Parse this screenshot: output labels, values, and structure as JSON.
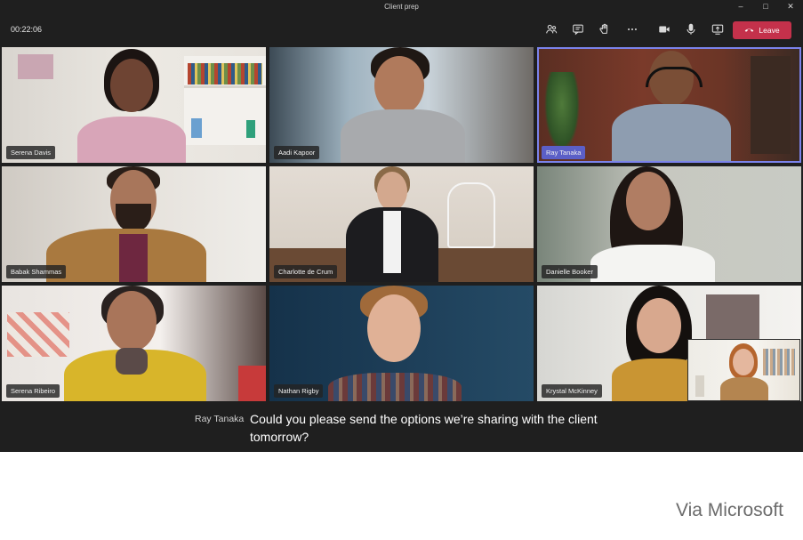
{
  "window": {
    "title": "Client prep"
  },
  "window_controls": {
    "minimize": "–",
    "maximize": "□",
    "close": "✕"
  },
  "toolbar": {
    "timer": "00:22:06",
    "icons": [
      "people-icon",
      "chat-icon",
      "raise-hand-icon",
      "more-icon",
      "camera-icon",
      "mic-icon",
      "share-screen-icon"
    ],
    "leave_label": "Leave"
  },
  "participants": [
    {
      "name": "Serena Davis"
    },
    {
      "name": "Aadi Kapoor"
    },
    {
      "name": "Ray Tanaka",
      "active": true
    },
    {
      "name": "Babak Shammas"
    },
    {
      "name": "Charlotte de Crum"
    },
    {
      "name": "Danielle Booker"
    },
    {
      "name": "Serena Ribeiro"
    },
    {
      "name": "Nathan Rigby"
    },
    {
      "name": "Krystal McKinney"
    }
  ],
  "caption": {
    "speaker": "Ray Tanaka",
    "text": "Could you please send the options we’re sharing with the client tomorrow?"
  },
  "credit": "Via Microsoft",
  "colors": {
    "accent": "#7b83eb",
    "leave": "#c4314b",
    "background": "#1f1f1f"
  }
}
